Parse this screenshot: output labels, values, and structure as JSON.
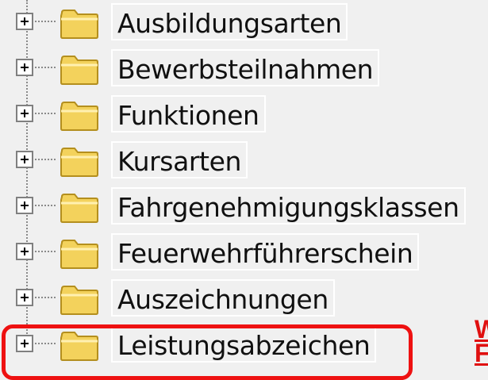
{
  "tree": {
    "items": [
      {
        "label": "Ausbildungsarten",
        "icon": "folder-icon"
      },
      {
        "label": "Bewerbsteilnahmen",
        "icon": "folder-icon"
      },
      {
        "label": "Funktionen",
        "icon": "folder-icon"
      },
      {
        "label": "Kursarten",
        "icon": "folder-icon"
      },
      {
        "label": "Fahrgenehmigungsklassen",
        "icon": "folder-icon"
      },
      {
        "label": "Feuerwehrführerschein",
        "icon": "folder-icon"
      },
      {
        "label": "Auszeichnungen",
        "icon": "folder-icon"
      },
      {
        "label": "Leistungsabzeichen",
        "icon": "folder-icon",
        "highlighted": true
      }
    ]
  },
  "annotation": {
    "text": "W\nF",
    "color": "#ee1111"
  },
  "colors": {
    "background": "#f0f0f0",
    "folder": "#f3d25c",
    "highlight": "#ee1111"
  }
}
